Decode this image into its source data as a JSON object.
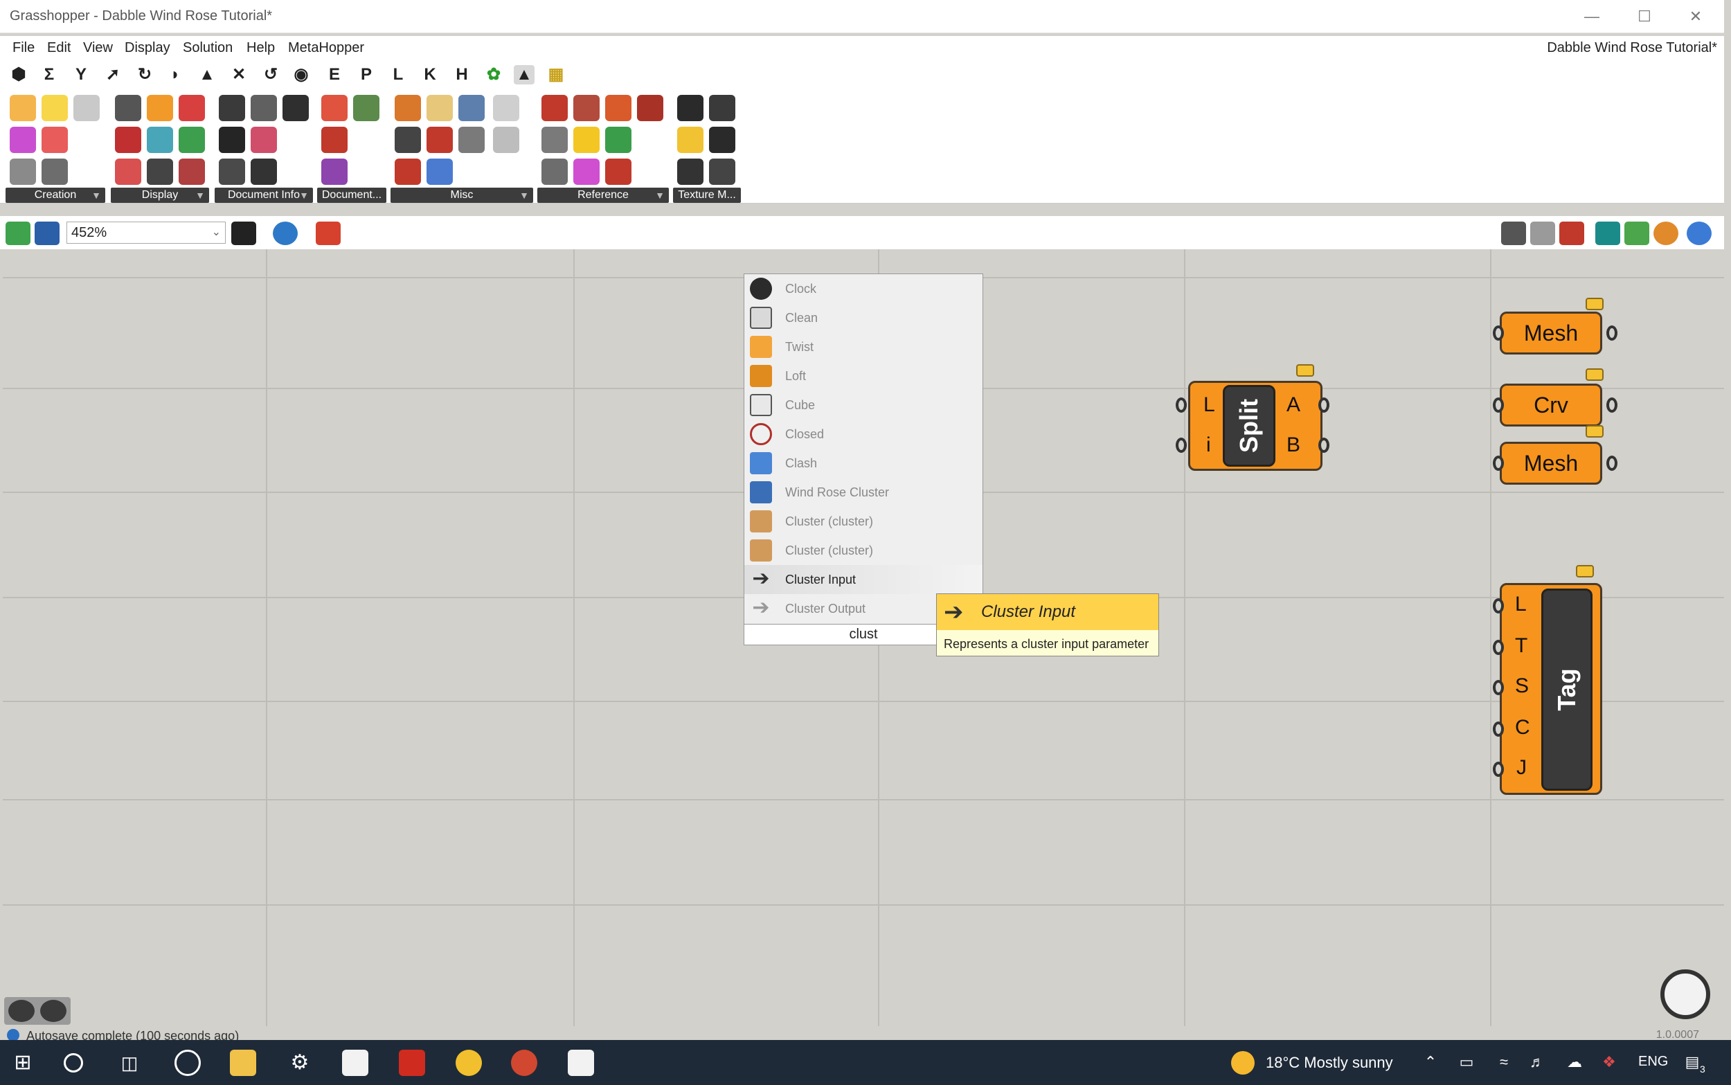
{
  "window": {
    "title": "Grasshopper - Dabble Wind Rose Tutorial*"
  },
  "menubar": {
    "items": [
      "File",
      "Edit",
      "View",
      "Display",
      "Solution",
      "Help",
      "MetaHopper"
    ],
    "document_title": "Dabble Wind Rose Tutorial*"
  },
  "quickbar": {
    "letters": [
      "E",
      "P",
      "L",
      "K",
      "H"
    ]
  },
  "ribbon": {
    "groups": [
      "Creation",
      "Display",
      "Document Info",
      "Document...",
      "Misc",
      "Reference",
      "Texture M..."
    ]
  },
  "canvas_toolbar": {
    "zoom": "452%"
  },
  "search_popup": {
    "items": [
      "Clock",
      "Clean",
      "Twist",
      "Loft",
      "Cube",
      "Closed",
      "Clash",
      "Wind Rose Cluster",
      "Cluster (cluster)",
      "Cluster (cluster)",
      "Cluster Input",
      "Cluster Output"
    ],
    "active_item": "Cluster Input",
    "query": "clust"
  },
  "tooltip": {
    "title": "Cluster Input",
    "description": "Represents a cluster input parameter"
  },
  "components": {
    "split": {
      "name": "Split",
      "inputs": [
        "L",
        "i"
      ],
      "outputs": [
        "A",
        "B"
      ]
    },
    "mesh1": {
      "name": "Mesh"
    },
    "crv": {
      "name": "Crv"
    },
    "mesh2": {
      "name": "Mesh"
    },
    "tag": {
      "name": "Tag",
      "inputs": [
        "L",
        "T",
        "S",
        "C",
        "J"
      ]
    }
  },
  "statusbar": {
    "message": "Autosave complete (100 seconds ago)",
    "version": "1.0.0007"
  },
  "taskbar": {
    "weather": "18°C  Mostly sunny",
    "language": "ENG",
    "notification_count": "3"
  }
}
